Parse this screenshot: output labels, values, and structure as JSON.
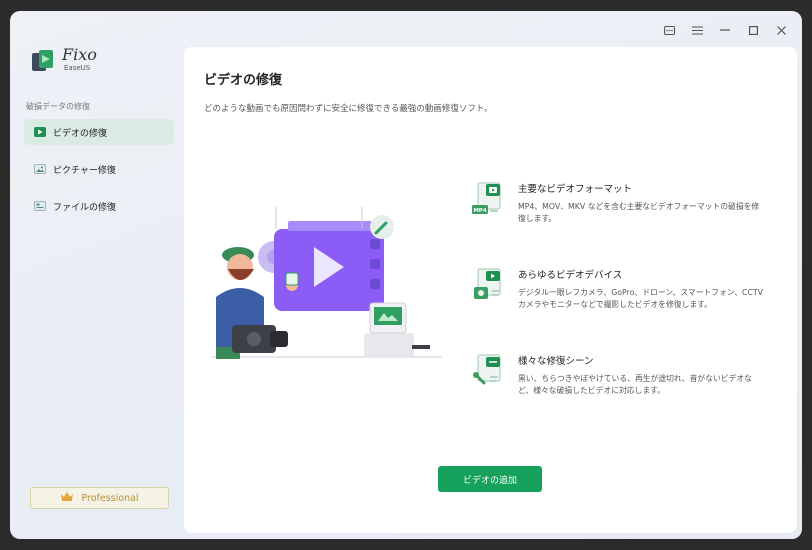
{
  "app": {
    "name": "Fixo",
    "vendor": "EaseUS"
  },
  "window_controls": [
    "feedback-icon",
    "menu-icon",
    "minimize-icon",
    "maximize-icon",
    "close-icon"
  ],
  "sidebar": {
    "section_label": "破損データの修復",
    "items": [
      {
        "label": "ビデオの修復",
        "icon": "video-icon",
        "active": true
      },
      {
        "label": "ピクチャー修復",
        "icon": "picture-icon",
        "active": false
      },
      {
        "label": "ファイルの修復",
        "icon": "file-icon",
        "active": false
      }
    ],
    "pro_label": "Professional"
  },
  "main": {
    "title": "ビデオの修復",
    "subtitle": "どのような動画でも原因問わずに安全に修復できる最強の動画修復ソフト。",
    "features": [
      {
        "title": "主要なビデオフォーマット",
        "desc": "MP4、MOV、MKV などを含む主要なビデオフォーマットの破損を修復します。",
        "icon": "video-format-icon",
        "badge": "MP4"
      },
      {
        "title": "あらゆるビデオデバイス",
        "desc": "デジタル一眼レフカメラ、GoPro、ドローン、スマートフォン、CCTVカメラやモニターなどで撮影したビデオを修復します。",
        "icon": "video-device-icon"
      },
      {
        "title": "様々な修復シーン",
        "desc": "黒い、ちらつきやぼやけている、再生が途切れ、音がないビデオなど、様々な破損したビデオに対応します。",
        "icon": "repair-scene-icon"
      }
    ],
    "add_button": "ビデオの追加"
  },
  "colors": {
    "accent": "#16a25c",
    "active_bg": "#d9ebe2",
    "pro_gold": "#b8913a",
    "illus_purple": "#8b5cf6"
  }
}
